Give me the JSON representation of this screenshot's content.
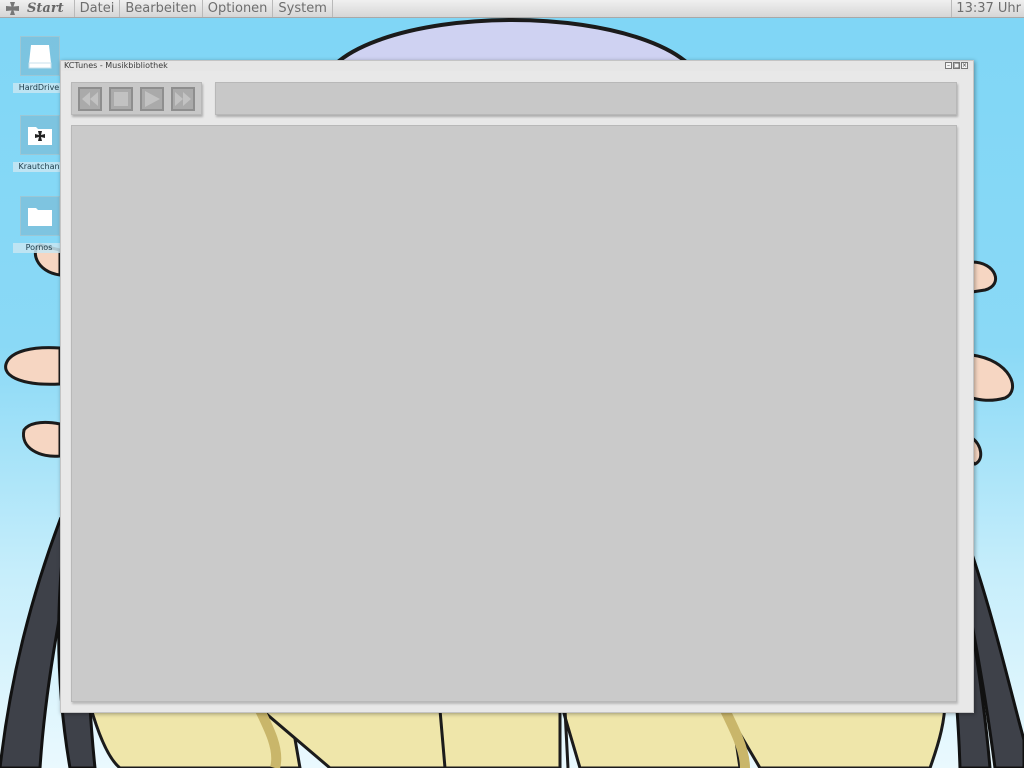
{
  "menubar": {
    "start_label": "Start",
    "items": [
      "Datei",
      "Bearbeiten",
      "Optionen",
      "System"
    ],
    "clock": "13:37 Uhr"
  },
  "desktop": {
    "icons": [
      {
        "label": "HardDrive",
        "icon": "hard-drive-icon"
      },
      {
        "label": "Krautchan",
        "icon": "folder-cross-icon"
      },
      {
        "label": "Pornos",
        "icon": "folder-icon"
      }
    ]
  },
  "window": {
    "title": "KCTunes - Musikbibliothek",
    "controls": [
      "minimize-icon",
      "maximize-icon",
      "close-icon"
    ],
    "transport": [
      "rewind-icon",
      "stop-icon",
      "play-icon",
      "fast-forward-icon"
    ],
    "now_playing": "",
    "library_items": []
  },
  "colors": {
    "sky": "#7fd6f6",
    "window_bg": "#e8e8e8",
    "panel": "#c8c8c8",
    "transport_button": "#aaaaaa"
  }
}
